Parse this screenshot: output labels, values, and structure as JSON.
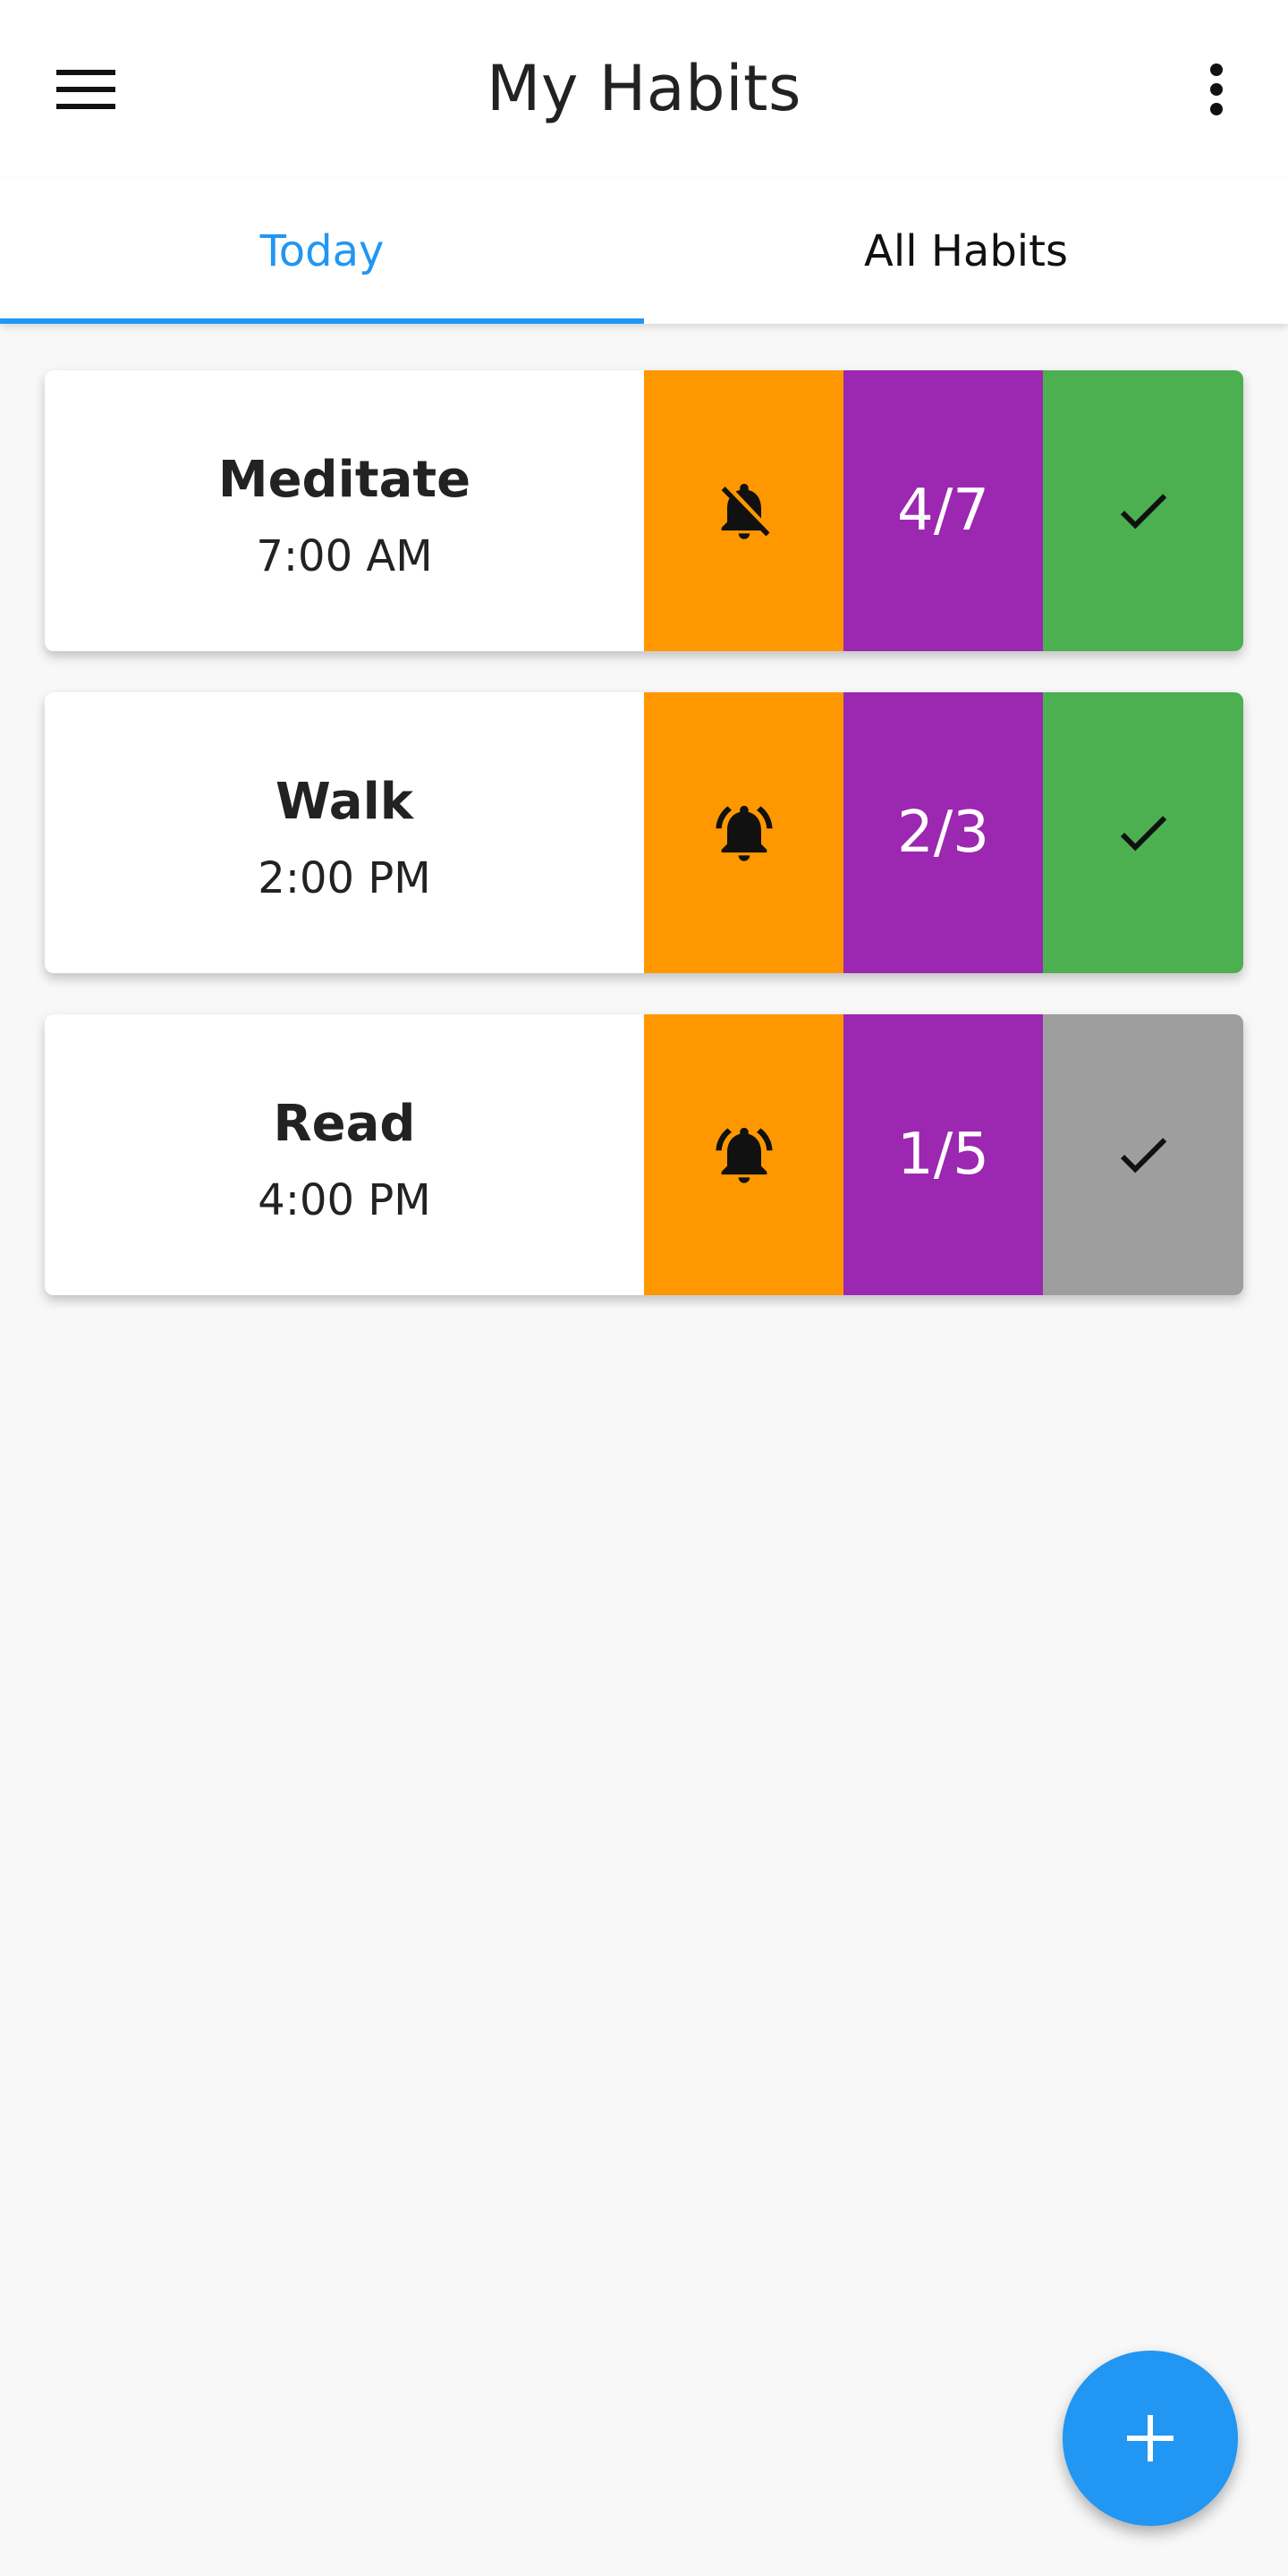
{
  "app": {
    "title": "My Habits"
  },
  "tabs": [
    {
      "label": "Today",
      "selected": true
    },
    {
      "label": "All Habits",
      "selected": false
    }
  ],
  "colors": {
    "accent": "#2196f3",
    "reminder": "#ff9800",
    "progress": "#9c27b0",
    "done": "#4caf50",
    "not_done": "#9e9e9e"
  },
  "habits": [
    {
      "name": "Meditate",
      "time": "7:00 AM",
      "reminder_icon": "bell-off-icon",
      "progress": "4/7",
      "completed": true
    },
    {
      "name": "Walk",
      "time": "2:00 PM",
      "reminder_icon": "bell-ring-icon",
      "progress": "2/3",
      "completed": true
    },
    {
      "name": "Read",
      "time": "4:00 PM",
      "reminder_icon": "bell-ring-icon",
      "progress": "1/5",
      "completed": false
    }
  ],
  "icons": {
    "menu": "menu-icon",
    "more": "more-vert-icon",
    "check": "check-icon",
    "add": "add-icon"
  }
}
